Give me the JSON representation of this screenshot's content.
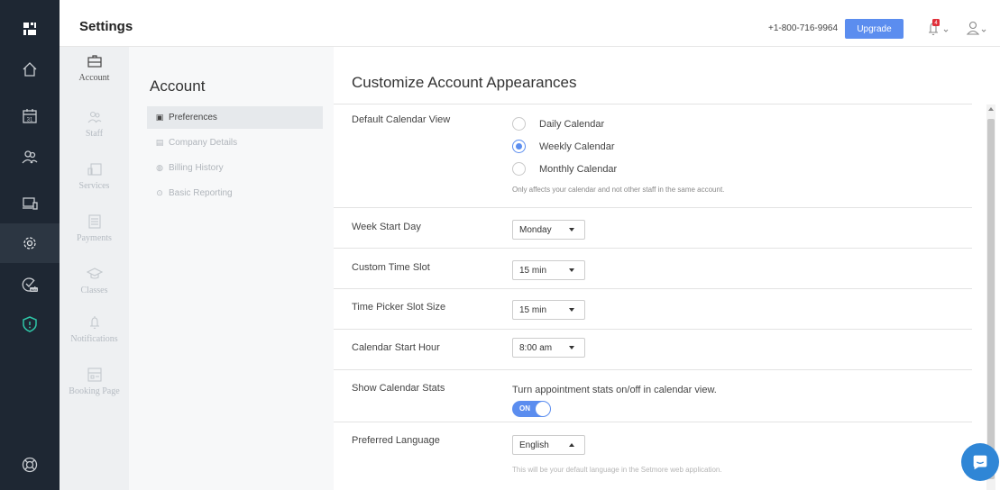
{
  "header": {
    "title": "Settings",
    "phone": "+1-800-716-9964",
    "upgrade_label": "Upgrade",
    "notification_count": "4"
  },
  "rail": {
    "items": [
      "logo-icon",
      "home-icon",
      "calendar-icon",
      "users-icon",
      "devices-icon",
      "gear-icon",
      "badge-check-icon",
      "shield-icon",
      "help-circle-icon"
    ],
    "calendar_day": "31",
    "badge_text": "BETA"
  },
  "section_nav": {
    "items": [
      {
        "label": "Account",
        "icon": "briefcase-icon",
        "active": true
      },
      {
        "label": "Staff",
        "icon": "staff-icon"
      },
      {
        "label": "Services",
        "icon": "services-icon"
      },
      {
        "label": "Payments",
        "icon": "payments-icon"
      },
      {
        "label": "Classes",
        "icon": "classes-icon"
      },
      {
        "label": "Notifications",
        "icon": "bell-icon"
      },
      {
        "label": "Booking Page",
        "icon": "booking-page-icon"
      }
    ]
  },
  "sub_nav": {
    "title": "Account",
    "items": [
      {
        "label": "Preferences",
        "glyph": "▣",
        "active": true
      },
      {
        "label": "Company Details",
        "glyph": "▤"
      },
      {
        "label": "Billing History",
        "glyph": "◍"
      },
      {
        "label": "Basic Reporting",
        "glyph": "⊙"
      }
    ]
  },
  "main": {
    "title": "Customize Account Appearances",
    "default_view": {
      "label": "Default Calendar View",
      "options": [
        "Daily Calendar",
        "Weekly Calendar",
        "Monthly Calendar"
      ],
      "selected": "Weekly Calendar",
      "helper": "Only affects your calendar and not other staff in the same account."
    },
    "week_start": {
      "label": "Week Start Day",
      "value": "Monday"
    },
    "time_slot": {
      "label": "Custom Time Slot",
      "value": "15 min"
    },
    "picker_slot": {
      "label": "Time Picker Slot Size",
      "value": "15 min"
    },
    "start_hour": {
      "label": "Calendar Start Hour",
      "value": "8:00 am"
    },
    "stats": {
      "label": "Show Calendar Stats",
      "description": "Turn appointment stats on/off in calendar view.",
      "toggle_label": "ON"
    },
    "language": {
      "label": "Preferred Language",
      "value": "English",
      "helper": "This will be your default language in the Setmore web application."
    }
  },
  "colors": {
    "rail_bg": "#1e2733",
    "accent": "#5b8def",
    "chat": "#2f86d6"
  }
}
